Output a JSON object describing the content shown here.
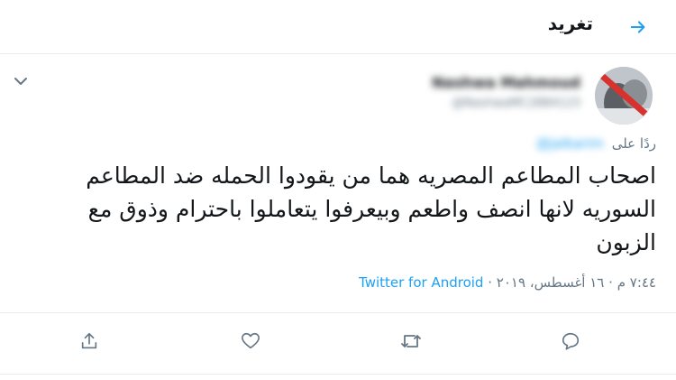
{
  "header": {
    "title": "تغريد",
    "back_icon": "arrow-right-icon"
  },
  "tweet": {
    "author_name": "Nashwa Mahmoud",
    "author_handle": "@NashwaMC2884123",
    "reply_prefix": "ردًا على",
    "reply_mention": "@jalkarim",
    "text_line1": "اصحاب المطاعم المصريه هما من يقودوا الحمله ضد المطاعم",
    "text_line2": "السوريه لانها انصف واطعم وبيعرفوا يتعاملوا باحترام وذوق مع",
    "text_line3": "الزبون",
    "time": "٧:٤٤ م",
    "date": "١٦ أغسطس، ٢٠١٩",
    "separator": "·",
    "source": "Twitter for Android"
  },
  "actions": {
    "reply_icon": "comment-icon",
    "retweet_icon": "retweet-icon",
    "like_icon": "heart-icon",
    "share_icon": "share-icon"
  },
  "colors": {
    "accent": "#1da1f2",
    "text": "#14171a",
    "muted": "#657786",
    "divider": "#e6ecf0"
  }
}
